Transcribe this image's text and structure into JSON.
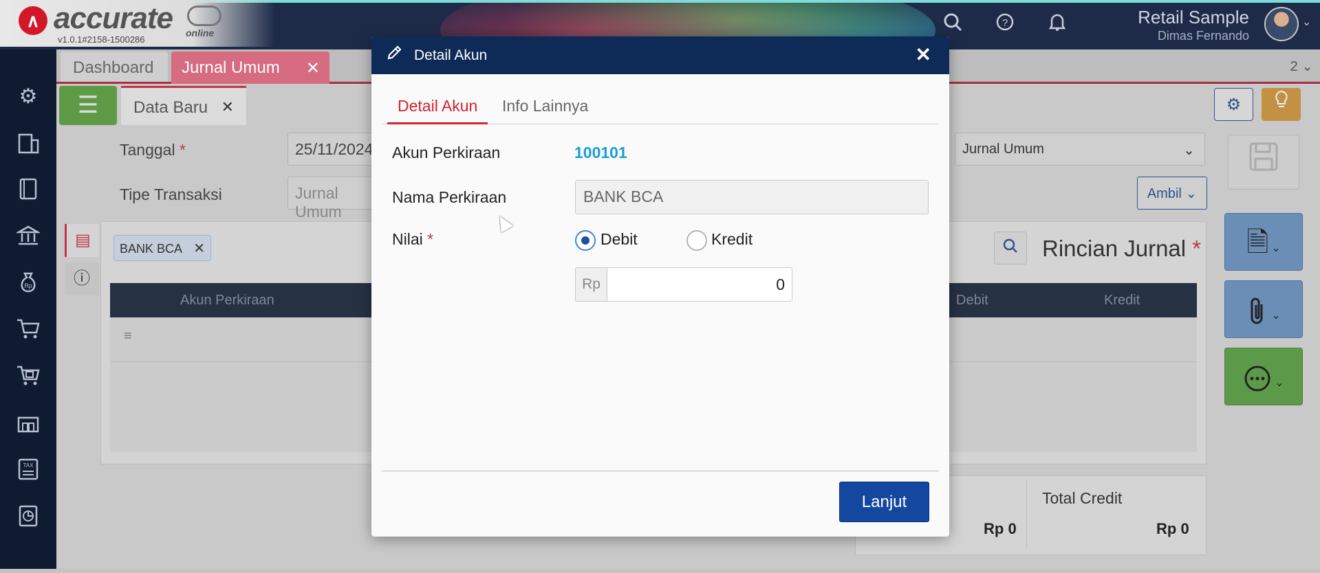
{
  "app": {
    "logo_text": "accurate",
    "logo_sub": "online",
    "version": "v1.0.1#2158-1500286",
    "company": "Retail Sample",
    "user": "Dimas Fernando"
  },
  "tabs": [
    {
      "label": "Dashboard"
    },
    {
      "label": "Jurnal Umum",
      "close": "✕"
    }
  ],
  "tab_count": "2 ⌄",
  "subtab": {
    "label": "Data Baru",
    "close": "✕"
  },
  "form": {
    "tanggal_label": "Tanggal",
    "tanggal_value": "25/11/2024",
    "tipe_label": "Tipe Transaksi",
    "tipe_value": "Jurnal Umum",
    "required_mark": "*",
    "select_value": "Jurnal Umum",
    "ambil_label": "Ambil"
  },
  "panel": {
    "chip": "BANK BCA",
    "heading": "Rincian Jurnal",
    "columns": [
      "Akun Perkiraan",
      "Debit",
      "Kredit"
    ]
  },
  "totals": {
    "credit_label": "Total Credit",
    "debit_value": "Rp 0",
    "credit_value": "Rp 0"
  },
  "modal": {
    "title": "Detail Akun",
    "close": "✕",
    "tabs": [
      "Detail Akun",
      "Info Lainnya"
    ],
    "akun_label": "Akun Perkiraan",
    "akun_value": "100101",
    "nama_label": "Nama Perkiraan",
    "nama_value": "BANK BCA",
    "nilai_label": "Nilai",
    "debit_label": "Debit",
    "kredit_label": "Kredit",
    "currency_prefix": "Rp",
    "amount": "0",
    "submit_label": "Lanjut"
  }
}
